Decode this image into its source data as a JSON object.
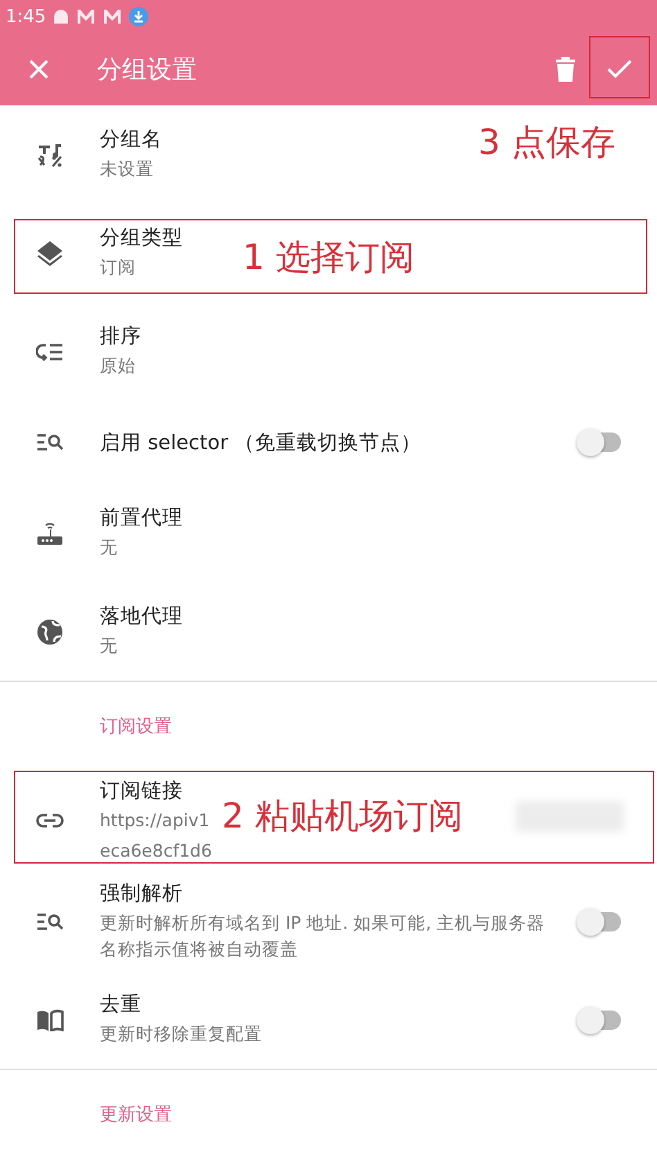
{
  "status_bar": {
    "time": "1:45"
  },
  "app_bar": {
    "title": "分组设置"
  },
  "items": [
    {
      "kind": "text",
      "title": "分组名",
      "subtitle": "未设置"
    },
    {
      "kind": "text",
      "title": "分组类型",
      "subtitle": "订阅"
    },
    {
      "kind": "text",
      "title": "排序",
      "subtitle": "原始"
    },
    {
      "kind": "toggle",
      "title": "启用 selector （免重载切换节点）",
      "on": false
    },
    {
      "kind": "text",
      "title": "前置代理",
      "subtitle": "无"
    },
    {
      "kind": "text",
      "title": "落地代理",
      "subtitle": "无"
    },
    {
      "kind": "section",
      "title": "订阅设置"
    },
    {
      "kind": "link",
      "title": "订阅链接",
      "lines": [
        "https://apiv1",
        "eca6e8cf1d6"
      ]
    },
    {
      "kind": "toggle",
      "title": "强制解析",
      "subtitle": "更新时解析所有域名到 IP 地址. 如果可能, 主机与服务器名称指示值将被自动覆盖",
      "on": false
    },
    {
      "kind": "toggle",
      "title": "去重",
      "subtitle": "更新时移除重复配置",
      "on": false
    },
    {
      "kind": "section",
      "title": "更新设置"
    }
  ],
  "annotations": [
    {
      "text": "3 点保存"
    },
    {
      "text": "1 选择订阅"
    },
    {
      "text": "2 粘贴机场订阅"
    }
  ]
}
